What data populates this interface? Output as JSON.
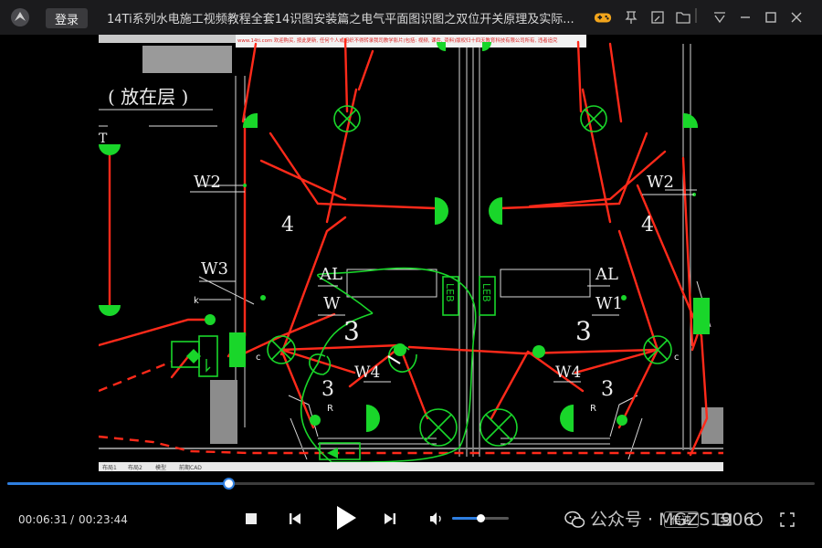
{
  "titlebar": {
    "login_label": "登录",
    "title": "14Ti系列水电施工视频教程全套14识图安装篇之电气平面图识图之双位开关原理及实际..."
  },
  "cad": {
    "banner": "www.14ti.com 欢迎购买, 按此更新, 任何个人或组织不得转录我司教学影片(包括: 视频, 课件, 资料)版权归十四天教育科技有限公司所有, 违者追究",
    "tabs": [
      "布局1",
      "布局2",
      "模型",
      "前期CAD"
    ],
    "labels": {
      "floor": "( 放在层 )",
      "w2_left": "W2",
      "w2_right": "W2",
      "w3": "W3",
      "four_left": "4",
      "four_right": "4",
      "al_left": "AL",
      "al_right": "AL",
      "w1_left": "W",
      "w1_right": "W1",
      "three_left": "3",
      "three_right": "3",
      "w4_left": "W4",
      "w4_right": "W4",
      "leb_left": "LEB",
      "leb_right": "LEB",
      "three_low_left": "3",
      "three_low_right": "3",
      "c_left": "c",
      "c_right": "c",
      "r_left": "R",
      "r_right": "R",
      "k_mark": "k",
      "tr": "T"
    }
  },
  "player": {
    "current_time": "00:06:31",
    "separator": "/",
    "total_time": "00:23:44",
    "progress": 0.274,
    "volume": 0.5,
    "speed_label": "倍速",
    "watermark": "公众号 · MGZS1906"
  },
  "colors": {
    "accent": "#2e7ee0",
    "cad_green": "#19d62a",
    "cad_red": "#ff2a1a",
    "cad_white": "#e8e8e8"
  }
}
